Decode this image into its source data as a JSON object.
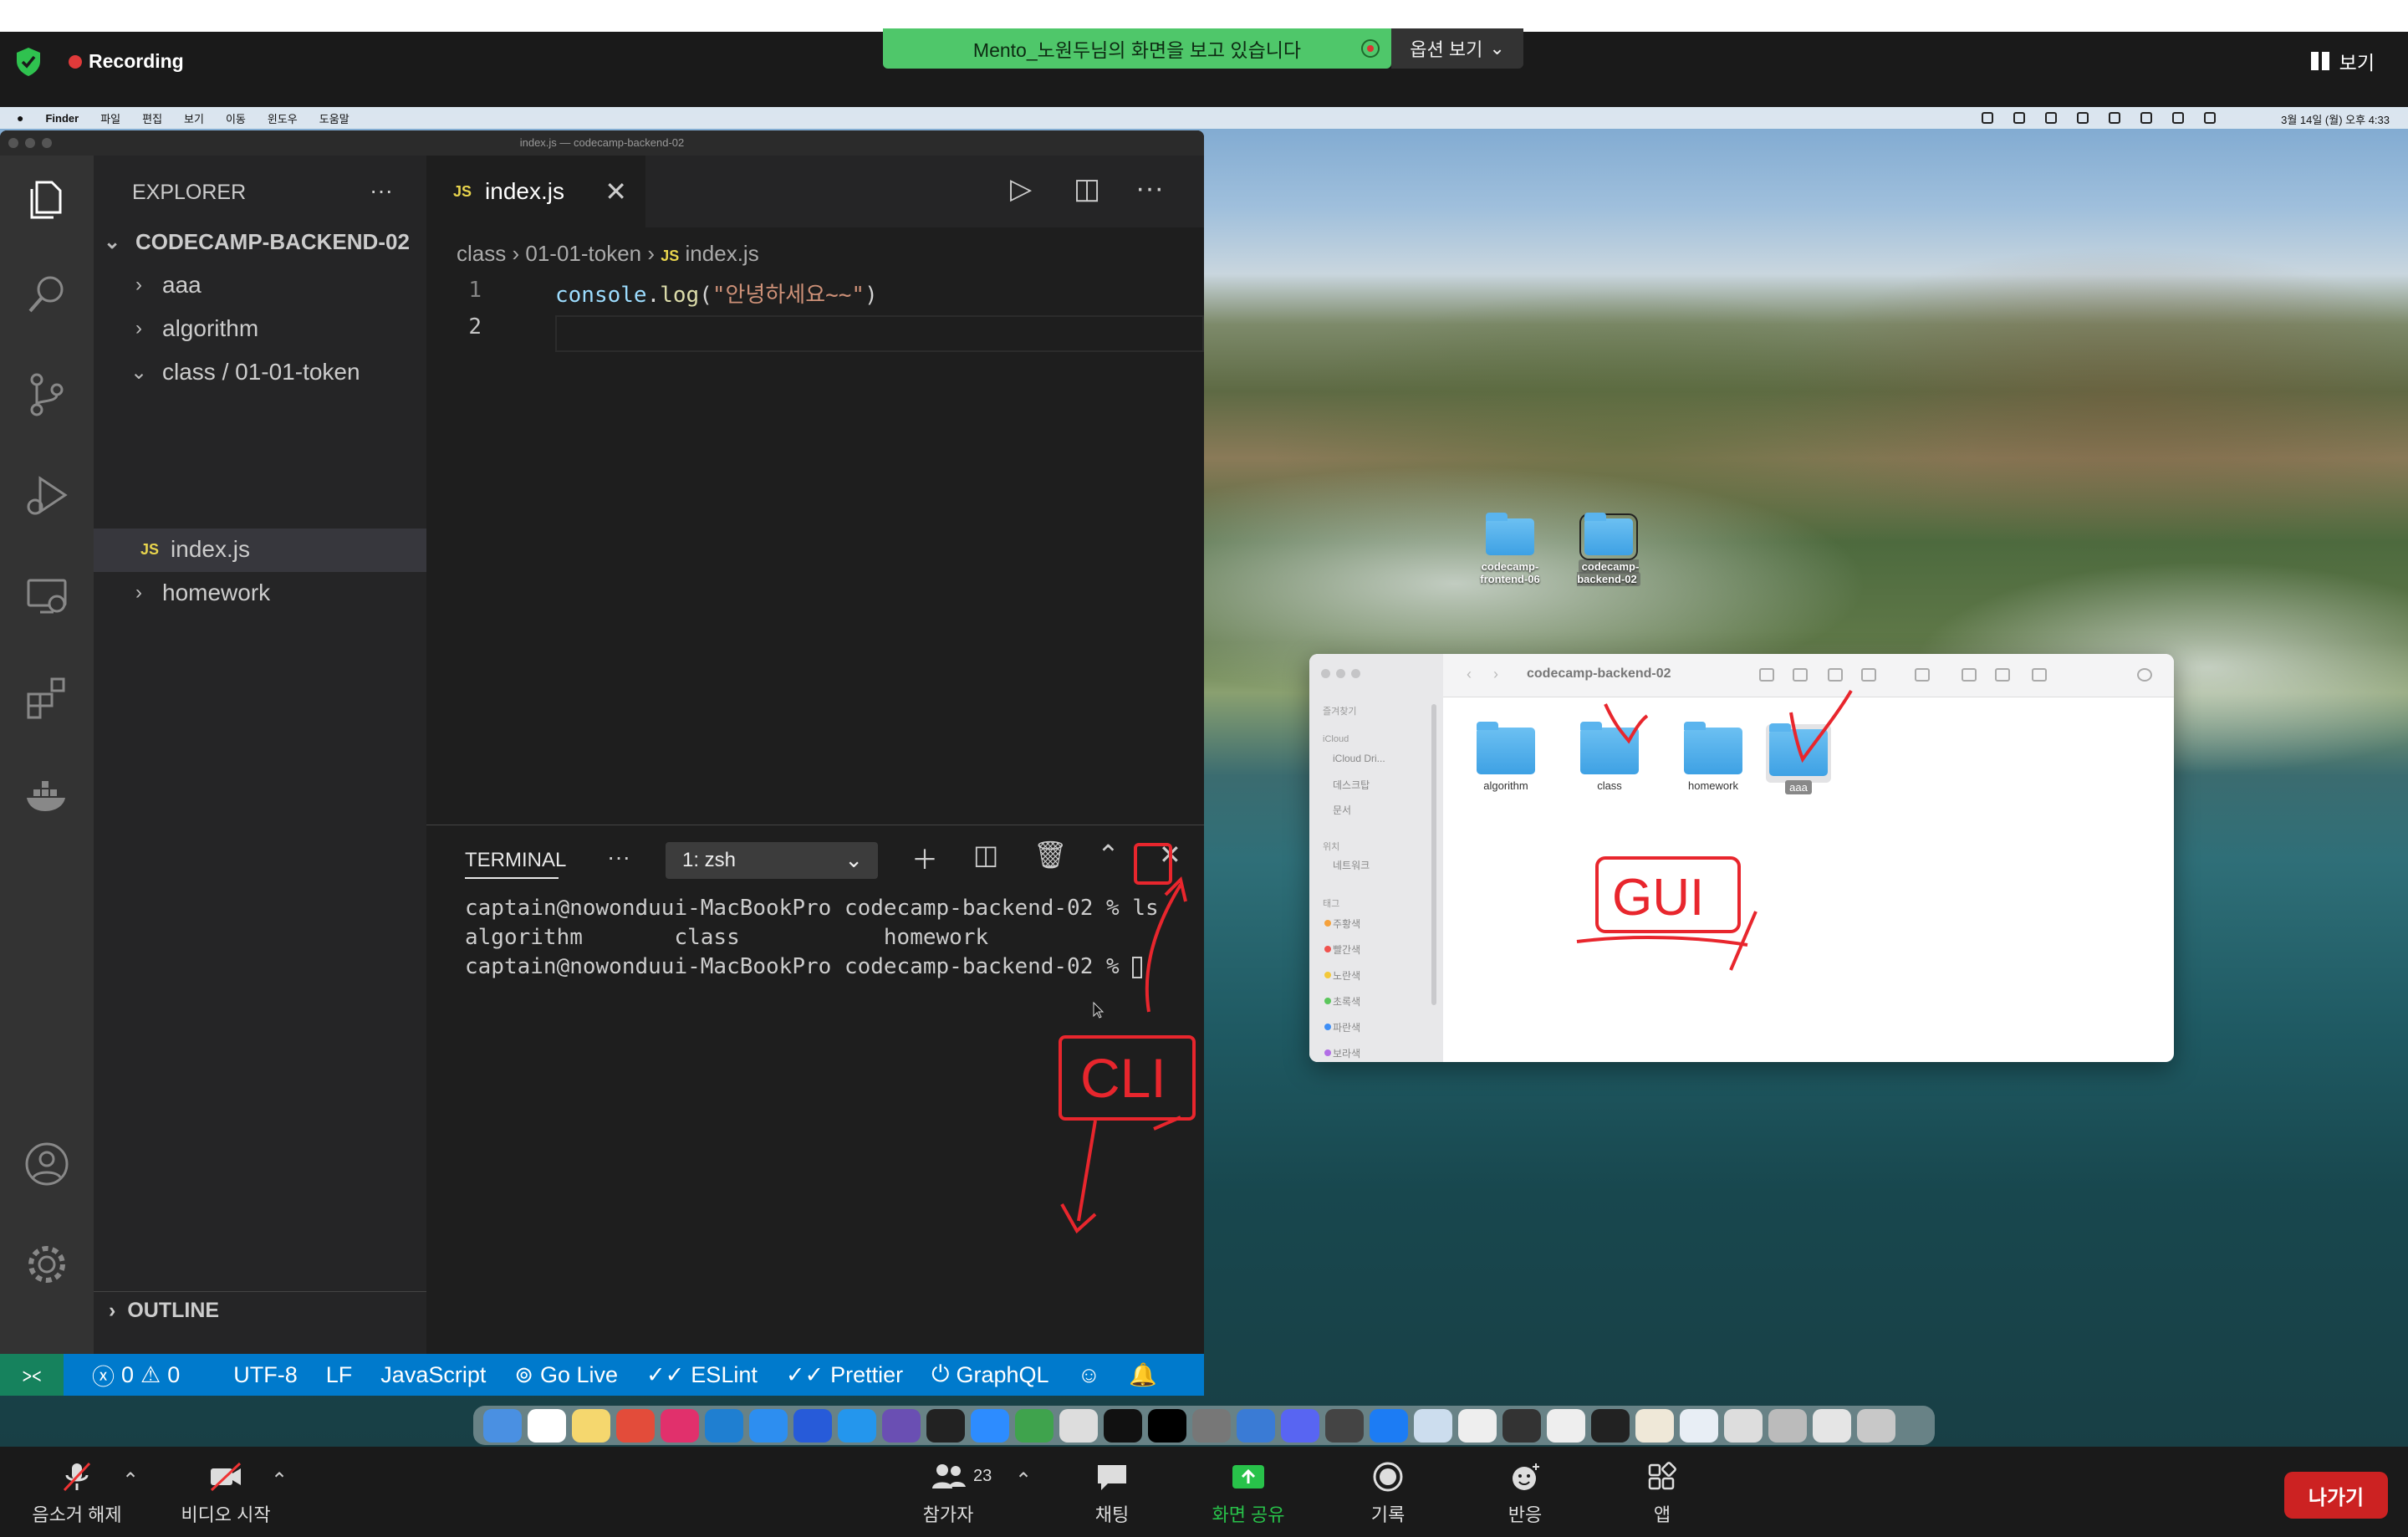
{
  "zoom_top": {
    "recording_label": "Recording",
    "viewing_banner": "Mento_노원두님의 화면을 보고 있습니다",
    "options_label": "옵션 보기",
    "view_label": "보기"
  },
  "mac_menubar": {
    "items": [
      "Finder",
      "파일",
      "편집",
      "보기",
      "이동",
      "윈도우",
      "도움말"
    ],
    "clock": "3월 14일 (월) 오후 4:33"
  },
  "vscode": {
    "window_title": "index.js — codecamp-backend-02",
    "explorer_title": "EXPLORER",
    "project": "CODECAMP-BACKEND-02",
    "tree": [
      {
        "label": "aaa",
        "chevron": "›"
      },
      {
        "label": "algorithm",
        "chevron": "›"
      },
      {
        "label": "class / 01-01-token",
        "chevron": "⌄"
      },
      {
        "label": "index.js",
        "chevron": ""
      },
      {
        "label": "homework",
        "chevron": "›"
      }
    ],
    "outline_label": "OUTLINE",
    "tab_label": "index.js",
    "js_badge": "JS",
    "breadcrumb": [
      "class",
      "01-01-token",
      "index.js"
    ],
    "code": {
      "line1": {
        "obj": "console",
        "dot": ".",
        "fn": "log",
        "open": "(",
        "str": "\"안녕하세요~~\"",
        "close": ")"
      },
      "line_numbers": [
        "1",
        "2"
      ]
    },
    "terminal": {
      "title": "TERMINAL",
      "shell": "1: zsh",
      "lines": [
        "captain@nowonduui-MacBookPro codecamp-backend-02 % ls",
        "algorithm       class           homework",
        "captain@nowonduui-MacBookPro codecamp-backend-02 % "
      ]
    },
    "status": {
      "errors": "0",
      "warnings": "0",
      "encoding": "UTF-8",
      "eol": "LF",
      "language": "JavaScript",
      "go_live": "Go Live",
      "eslint": "ESLint",
      "prettier": "Prettier",
      "graphql": "GraphQL"
    }
  },
  "desktop": {
    "icons": [
      "codecamp-frontend-06",
      "codecamp-backend-02"
    ]
  },
  "finder": {
    "title": "codecamp-backend-02",
    "sidebar_sections": [
      "즐겨찾기",
      "iCloud",
      "위치",
      "태그"
    ],
    "sidebar_items": [
      "iCloud Dri...",
      "데스크탑",
      "문서",
      "네트워크"
    ],
    "tags": [
      {
        "label": "주황색",
        "color": "#f5a13c"
      },
      {
        "label": "빨간색",
        "color": "#f0524e"
      },
      {
        "label": "노란색",
        "color": "#f3c83a"
      },
      {
        "label": "초록색",
        "color": "#5bc65c"
      },
      {
        "label": "파란색",
        "color": "#3e8ef5"
      },
      {
        "label": "보라색",
        "color": "#b26ee6"
      }
    ],
    "items": [
      "algorithm",
      "class",
      "homework",
      "aaa"
    ]
  },
  "annotations": {
    "cli": "CLI",
    "gui": "GUI"
  },
  "zoom_bottom": {
    "mute": "음소거 해제",
    "video": "비디오 시작",
    "participants": "참가자",
    "participant_count": "23",
    "chat": "채팅",
    "share": "화면 공유",
    "record": "기록",
    "reactions": "반응",
    "apps": "앱",
    "leave": "나가기",
    "share_color": "#28c24a",
    "leave_color": "#cc2222"
  }
}
